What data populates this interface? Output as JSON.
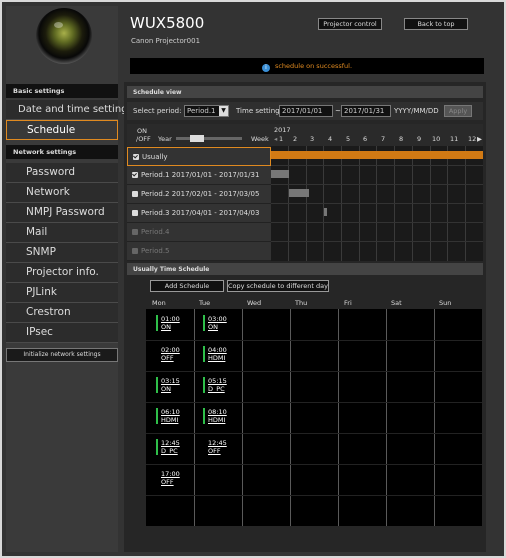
{
  "header": {
    "model": "WUX5800",
    "projector_name": "Canon Projector001",
    "projector_control_label": "Projector control",
    "back_to_top_label": "Back to top",
    "status_message": "schedule on successful."
  },
  "sidebar": {
    "basic_settings_title": "Basic settings",
    "basic_items": [
      "Date and time settings",
      "Schedule"
    ],
    "network_settings_title": "Network settings",
    "network_items": [
      "Password",
      "Network",
      "NMPJ Password",
      "Mail",
      "SNMP",
      "Projector info.",
      "PJLink",
      "Crestron",
      "IPsec"
    ],
    "init_button_label": "Initialize network settings",
    "selected_item": "Schedule",
    "accent_color": "#e08a20"
  },
  "schedule_view": {
    "title": "Schedule view",
    "select_period_label": "Select period:",
    "select_period_value": "Period.1",
    "time_setting_label": "Time setting:",
    "date_from": "2017/01/01",
    "date_sep": "~",
    "date_to": "2017/01/31",
    "date_format": "YYYY/MM/DD",
    "apply_label": "Apply",
    "onoff_line1": "ON",
    "onoff_line2": "/OFF",
    "year_label": "Year",
    "week_label": "Week",
    "year_value": "2017",
    "week_numbers": [
      "1",
      "2",
      "3",
      "4",
      "5",
      "6",
      "7",
      "8",
      "9",
      "10",
      "11",
      "12"
    ],
    "next_arrow": "▶",
    "periods": [
      {
        "label": "Usually",
        "checked": true,
        "enabled": true
      },
      {
        "label": "Period.1 2017/01/01 - 2017/01/31",
        "checked": true,
        "enabled": true
      },
      {
        "label": "Period.2 2017/02/01 - 2017/03/05",
        "checked": false,
        "enabled": true
      },
      {
        "label": "Period.3 2017/04/01 - 2017/04/03",
        "checked": false,
        "enabled": true
      },
      {
        "label": "Period.4",
        "checked": false,
        "enabled": false
      },
      {
        "label": "Period.5",
        "checked": false,
        "enabled": false
      }
    ]
  },
  "usually_schedule": {
    "title": "Usually Time Schedule",
    "add_schedule_label": "Add Schedule",
    "copy_schedule_label": "Copy schedule to different day",
    "days": [
      "Mon",
      "Tue",
      "Wed",
      "Thu",
      "Fri",
      "Sat",
      "Sun"
    ],
    "mon_entries": [
      {
        "time": "01:00",
        "action": "ON"
      },
      {
        "time": "02:00",
        "action": "OFF"
      },
      {
        "time": "03:15",
        "action": "ON"
      },
      {
        "time": "06:10",
        "action": "HDMI"
      },
      {
        "time": "12:45",
        "action": "D_PC"
      },
      {
        "time": "17:00",
        "action": "OFF"
      }
    ],
    "tue_entries": [
      {
        "time": "03:00",
        "action": "ON"
      },
      {
        "time": "04:00",
        "action": "HDMI"
      },
      {
        "time": "05:15",
        "action": "D_PC"
      },
      {
        "time": "08:10",
        "action": "HDMI"
      },
      {
        "time": "12:45",
        "action": "OFF"
      }
    ]
  }
}
